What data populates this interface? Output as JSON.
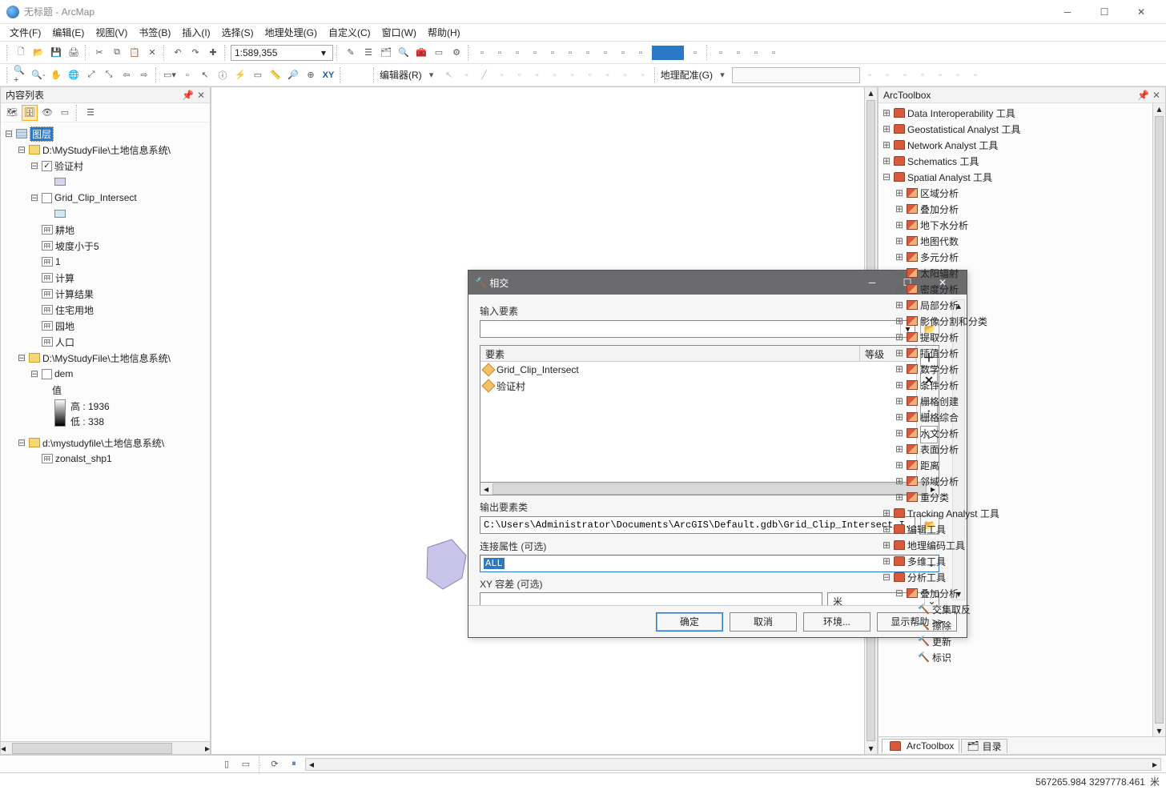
{
  "window": {
    "app": "ArcMap",
    "title": "无标题 - ArcMap"
  },
  "menubar": [
    "文件(F)",
    "编辑(E)",
    "视图(V)",
    "书签(B)",
    "插入(I)",
    "选择(S)",
    "地理处理(G)",
    "自定义(C)",
    "窗口(W)",
    "帮助(H)"
  ],
  "scale": "1:589,355",
  "toolbar_labels": {
    "editor": "编辑器(R)",
    "georef": "地理配准(G)"
  },
  "toc": {
    "title": "内容列表",
    "root": "图层",
    "ds1": "D:\\MyStudyFile\\土地信息系统\\",
    "lyr_yz": "验证村",
    "lyr_grid": "Grid_Clip_Intersect",
    "tables": [
      "耕地",
      "坡度小于5",
      "1",
      "计算",
      "计算结果",
      "住宅用地",
      "园地",
      "人口"
    ],
    "ds2": "D:\\MyStudyFile\\土地信息系统\\",
    "dem": "dem",
    "dem_val": "值",
    "dem_high": "高 : 1936",
    "dem_low": "低 : 338",
    "ds3": "d:\\mystudyfile\\土地信息系统\\",
    "zonal": "zonalst_shp1"
  },
  "toolbox": {
    "title": "ArcToolbox",
    "roots": [
      "Data Interoperability 工具",
      "Geostatistical Analyst 工具",
      "Network Analyst 工具",
      "Schematics 工具"
    ],
    "sa": "Spatial Analyst 工具",
    "sa_groups": [
      "区域分析",
      "叠加分析",
      "地下水分析",
      "地图代数",
      "多元分析",
      "太阳辐射",
      "密度分析",
      "局部分析",
      "影像分割和分类",
      "提取分析",
      "插值分析",
      "数学分析",
      "条件分析",
      "栅格创建",
      "栅格综合",
      "水文分析",
      "表面分析",
      "距离",
      "邻域分析",
      "重分类"
    ],
    "after_sa": [
      "Tracking Analyst 工具",
      "编辑工具",
      "地理编码工具",
      "多维工具"
    ],
    "fx": "分析工具",
    "fx_group": "叠加分析",
    "fx_tools": [
      "交集取反",
      "擦除",
      "更新",
      "标识"
    ],
    "tabs": {
      "arc": "ArcToolbox",
      "cat": "目录"
    }
  },
  "dialog": {
    "title": "相交",
    "input_label": "输入要素",
    "feat_header_a": "要素",
    "feat_header_b": "等级",
    "features": [
      "Grid_Clip_Intersect",
      "验证村"
    ],
    "out_label": "输出要素类",
    "out_value": "C:\\Users\\Administrator\\Documents\\ArcGIS\\Default.gdb\\Grid_Clip_Intersect_I...",
    "join_label": "连接属性 (可选)",
    "join_value": "ALL",
    "xy_label": "XY 容差 (可选)",
    "xy_unit": "米",
    "btn_ok": "确定",
    "btn_cancel": "取消",
    "btn_env": "环境...",
    "btn_help": "显示帮助 >>"
  },
  "status": {
    "coords": "567265.984 3297778.461",
    "unit": "米"
  }
}
